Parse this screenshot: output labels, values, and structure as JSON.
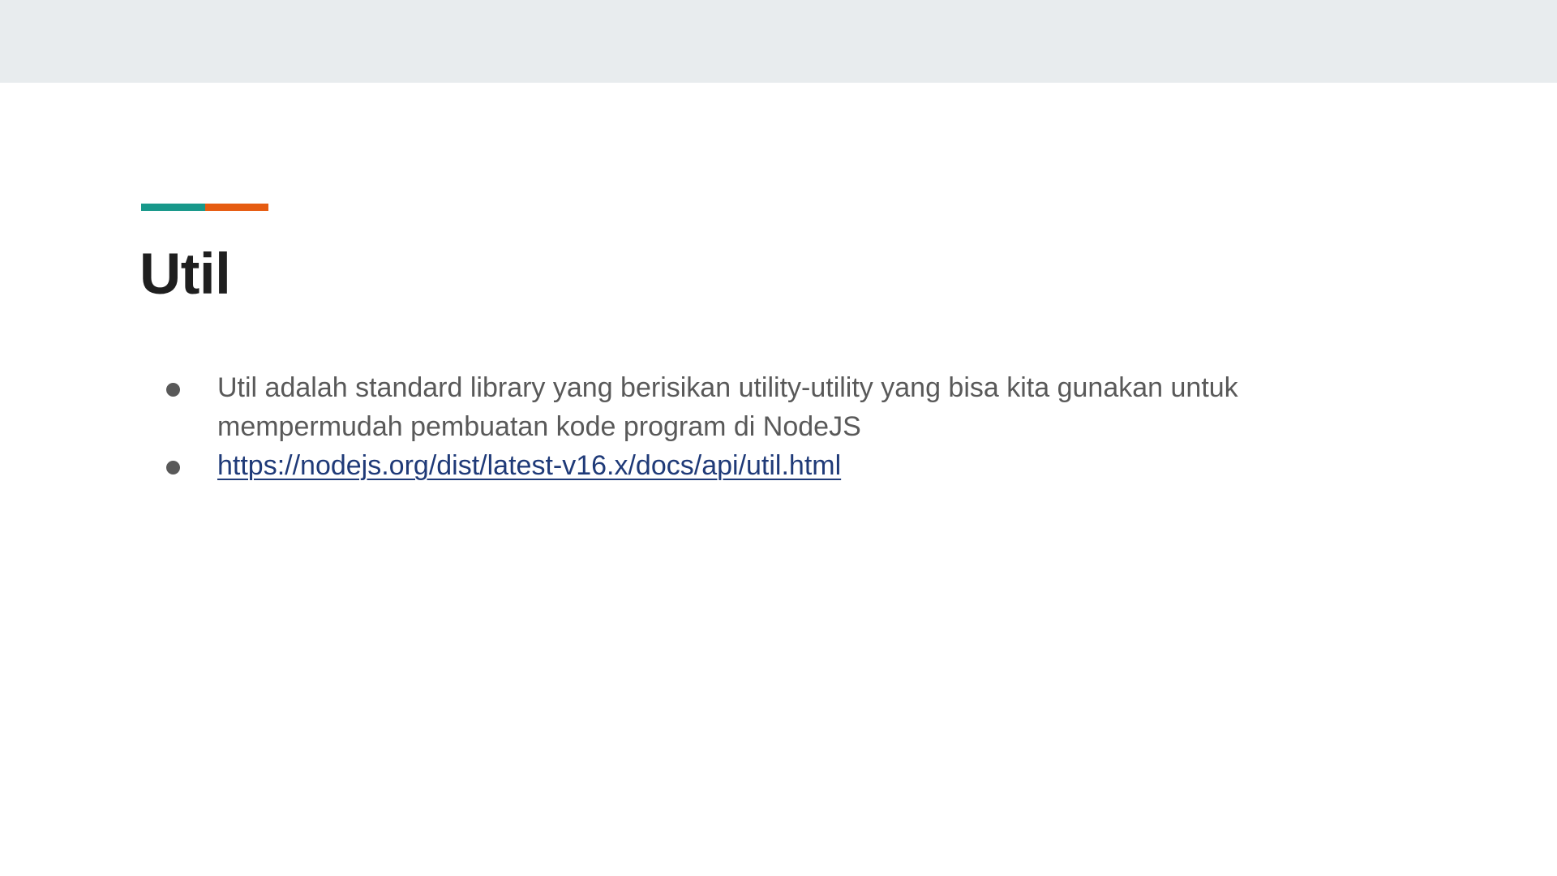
{
  "slide": {
    "title": "Util",
    "accent_colors": [
      "#17988a",
      "#e65c11"
    ],
    "bullets": [
      {
        "text": "Util adalah standard library yang berisikan utility-utility yang bisa kita gunakan untuk mempermudah pembuatan kode program di NodeJS"
      },
      {
        "link": "https://nodejs.org/dist/latest-v16.x/docs/api/util.html"
      }
    ]
  }
}
